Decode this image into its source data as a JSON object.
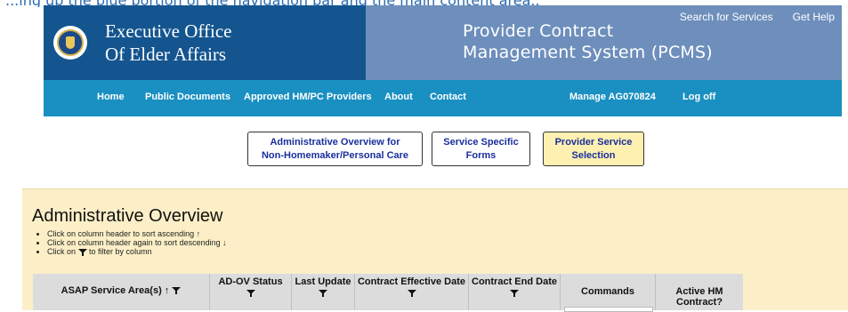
{
  "header": {
    "agency_line1": "Executive Office",
    "agency_line2": "Of Elder Affairs",
    "system_line1": "Provider Contract",
    "system_line2": "Management System (PCMS)",
    "util_links": [
      "Search for Services",
      "Get Help"
    ]
  },
  "top_cut_text": "...ing up the blue portion of the navigation bar and the main content area...",
  "nav": {
    "items": [
      "Home",
      "Public Documents",
      "Approved HM/PC Providers",
      "About",
      "Contact",
      "Manage AG070824",
      "Log off"
    ]
  },
  "tabs": [
    {
      "line1": "Administrative Overview for",
      "line2": "Non-Homemaker/Personal Care",
      "active": false
    },
    {
      "line1": "Service Specific",
      "line2": "Forms",
      "active": false
    },
    {
      "line1": "Provider Service",
      "line2": "Selection",
      "active": true
    }
  ],
  "overview": {
    "title": "Administrative Overview",
    "bullet1": "Click on column header to sort ascending ↑",
    "bullet2": "Click on column header again to sort descending ↓",
    "bullet3_pre": "Click on",
    "bullet3_post": "to filter by column"
  },
  "table": {
    "columns": [
      "ASAP Service Area(s) ↑",
      "AD-OV Status",
      "Last Update",
      "Contract Effective Date",
      "Contract End Date",
      "Commands",
      "Active HM Contract?"
    ]
  },
  "colors": {
    "brand_blue": "#14558f",
    "system_blue": "#6e8fbc",
    "nav_blue": "#1a8fc1",
    "panel_bg": "#fcefc7",
    "active_tab_bg": "#fdf0b0",
    "tab_text": "#1a2f9e"
  }
}
